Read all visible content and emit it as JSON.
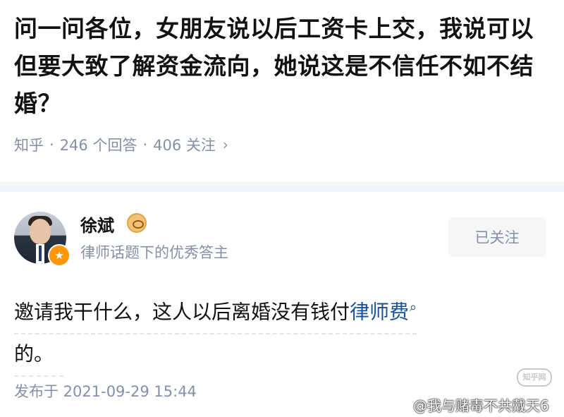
{
  "question": {
    "title": "问一问各位，女朋友说以后工资卡上交，我说可以但要大致了解资金流向，她说这是不信任不如不结婚？",
    "source": "知乎",
    "answers": "246 个回答",
    "followers": "406 关注",
    "chevron": "›"
  },
  "author": {
    "name": "徐斌",
    "description": "律师话题下的优秀答主",
    "follow_label": "已关注",
    "badge_icon": "star-icon",
    "name_badge_icon": "eye-badge-icon",
    "badge_glyph": "★"
  },
  "answer": {
    "text_before": "邀请我干什么，这人以后离婚没有钱付",
    "keyword": "律师费",
    "keyword_icon_glyph": "⌕",
    "text_after": "的。"
  },
  "published": "发布于 2021-09-29 15:44",
  "watermark": {
    "logo_text": "知乎网",
    "credit": "@我与赌毒不共戴天6"
  },
  "colors": {
    "meta_gray": "#8590a6",
    "link_blue": "#175199",
    "badge_orange": "#ff9607",
    "divider": "#f4f5f7"
  }
}
